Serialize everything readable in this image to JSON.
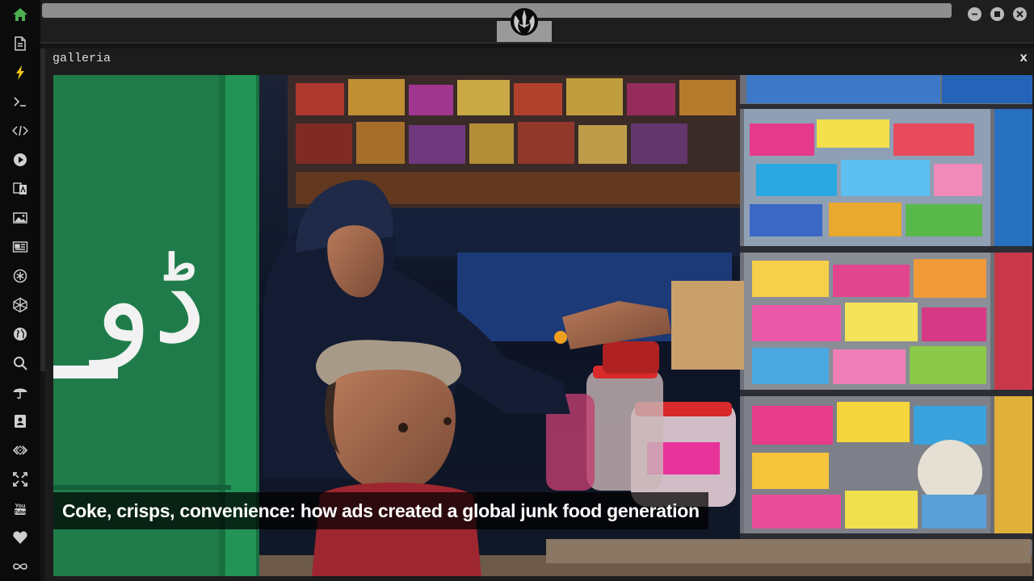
{
  "sidebar": {
    "items": [
      {
        "icon": "home-icon",
        "active": true
      },
      {
        "icon": "document-icon"
      },
      {
        "icon": "lightning-icon",
        "highlight": true
      },
      {
        "icon": "terminal-icon"
      },
      {
        "icon": "code-icon"
      },
      {
        "icon": "play-icon"
      },
      {
        "icon": "translate-icon"
      },
      {
        "icon": "image-icon"
      },
      {
        "icon": "newspaper-icon"
      },
      {
        "icon": "settings-icon"
      },
      {
        "icon": "hexagon-icon"
      },
      {
        "icon": "globe-icon"
      },
      {
        "icon": "search-icon"
      },
      {
        "icon": "umbrella-icon"
      },
      {
        "icon": "contact-icon"
      },
      {
        "icon": "embed-icon"
      },
      {
        "icon": "fullscreen-icon"
      },
      {
        "icon": "youtube-icon"
      },
      {
        "icon": "heart-icon"
      },
      {
        "icon": "infinity-icon"
      }
    ],
    "accent_color": "#4caf50",
    "highlight_color": "#f0c419"
  },
  "topbar": {
    "url_value": "",
    "logo_icon": "rebel-alliance-icon",
    "buttons": [
      "minimize-icon",
      "maximize-icon",
      "close-icon"
    ]
  },
  "window": {
    "title": "galleria",
    "close_label": "x"
  },
  "gallery": {
    "caption": "Coke, crisps, convenience: how ads created a global junk food generation",
    "sign_text": "ڈو"
  }
}
